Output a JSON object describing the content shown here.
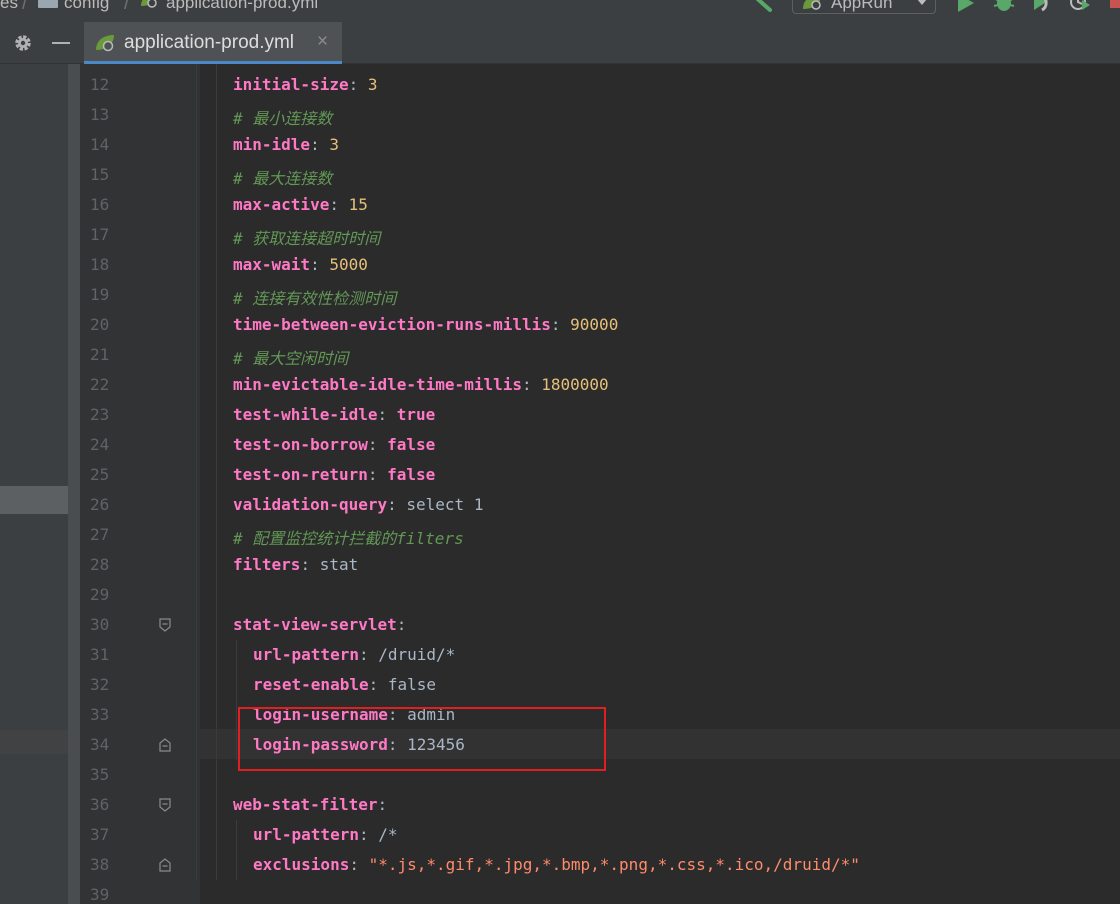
{
  "breadcrumb": {
    "items": [
      "es",
      "config",
      "application-prod.yml"
    ]
  },
  "toolbar": {
    "run_config_label": "AppRun"
  },
  "tabs": [
    {
      "label": "application-prod.yml",
      "close": "×",
      "active": true
    }
  ],
  "colors": {
    "key": "#ff79c6",
    "number": "#e6c07b",
    "comment": "#629755",
    "string": "#ff8b6b",
    "plain": "#a9b7c6",
    "highlight_box": "#e02020"
  },
  "editor": {
    "lines": [
      {
        "n": "12",
        "indent": 0,
        "key": "initial-size",
        "sep": ": ",
        "val": "3",
        "type": "number"
      },
      {
        "n": "13",
        "indent": 0,
        "comment": "# 最小连接数"
      },
      {
        "n": "14",
        "indent": 0,
        "key": "min-idle",
        "sep": ": ",
        "val": "3",
        "type": "number"
      },
      {
        "n": "15",
        "indent": 0,
        "comment": "# 最大连接数"
      },
      {
        "n": "16",
        "indent": 0,
        "key": "max-active",
        "sep": ": ",
        "val": "15",
        "type": "number"
      },
      {
        "n": "17",
        "indent": 0,
        "comment": "# 获取连接超时时间"
      },
      {
        "n": "18",
        "indent": 0,
        "key": "max-wait",
        "sep": ": ",
        "val": "5000",
        "type": "number"
      },
      {
        "n": "19",
        "indent": 0,
        "comment": "# 连接有效性检测时间"
      },
      {
        "n": "20",
        "indent": 0,
        "key": "time-between-eviction-runs-millis",
        "sep": ": ",
        "val": "90000",
        "type": "number"
      },
      {
        "n": "21",
        "indent": 0,
        "comment": "# 最大空闲时间"
      },
      {
        "n": "22",
        "indent": 0,
        "key": "min-evictable-idle-time-millis",
        "sep": ": ",
        "val": "1800000",
        "type": "number"
      },
      {
        "n": "23",
        "indent": 0,
        "key": "test-while-idle",
        "sep": ": ",
        "val": "true",
        "type": "bool"
      },
      {
        "n": "24",
        "indent": 0,
        "key": "test-on-borrow",
        "sep": ": ",
        "val": "false",
        "type": "bool"
      },
      {
        "n": "25",
        "indent": 0,
        "key": "test-on-return",
        "sep": ": ",
        "val": "false",
        "type": "bool"
      },
      {
        "n": "26",
        "indent": 0,
        "key": "validation-query",
        "sep": ": ",
        "val": "select 1",
        "type": "plain"
      },
      {
        "n": "27",
        "indent": 0,
        "comment": "# 配置监控统计拦截的filters"
      },
      {
        "n": "28",
        "indent": 0,
        "key": "filters",
        "sep": ": ",
        "val": "stat",
        "type": "plain"
      },
      {
        "n": "29",
        "indent": 0
      },
      {
        "n": "30",
        "indent": 0,
        "key": "stat-view-servlet",
        "sep": ":",
        "val": "",
        "type": "plain",
        "fold": "open"
      },
      {
        "n": "31",
        "indent": 1,
        "key": "url-pattern",
        "sep": ": ",
        "val": "/druid/*",
        "type": "plain"
      },
      {
        "n": "32",
        "indent": 1,
        "key": "reset-enable",
        "sep": ": ",
        "val": "false",
        "type": "plain"
      },
      {
        "n": "33",
        "indent": 1,
        "key": "login-username",
        "sep": ": ",
        "val": "admin",
        "type": "plain"
      },
      {
        "n": "34",
        "indent": 1,
        "key": "login-password",
        "sep": ": ",
        "val": "123456",
        "type": "plain",
        "fold": "close",
        "current": true
      },
      {
        "n": "35",
        "indent": 0
      },
      {
        "n": "36",
        "indent": 0,
        "key": "web-stat-filter",
        "sep": ":",
        "val": "",
        "type": "plain",
        "fold": "open"
      },
      {
        "n": "37",
        "indent": 1,
        "key": "url-pattern",
        "sep": ": ",
        "val": "/*",
        "type": "plain"
      },
      {
        "n": "38",
        "indent": 1,
        "key": "exclusions",
        "sep": ": ",
        "val": "\"*.js,*.gif,*.jpg,*.bmp,*.png,*.css,*.ico,/druid/*\"",
        "type": "string",
        "fold": "close"
      },
      {
        "n": "39",
        "indent": 0
      }
    ]
  }
}
